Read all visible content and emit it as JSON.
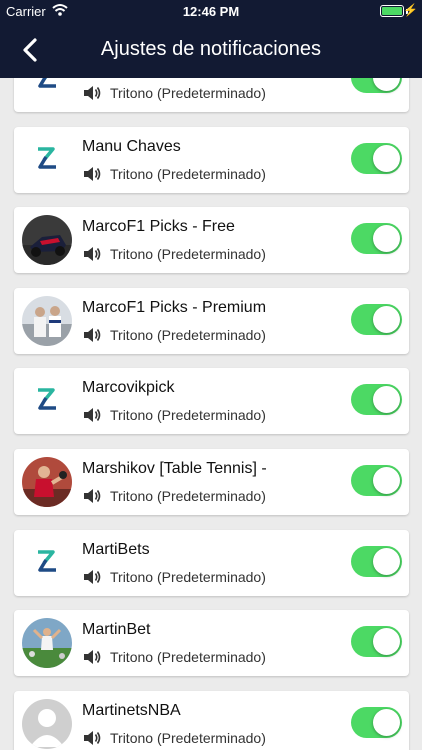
{
  "status_bar": {
    "carrier": "Carrier",
    "time": "12:46 PM",
    "wifi_icon": "wifi-icon",
    "battery_icon": "battery-icon",
    "charging_icon": "charging-bolt-icon"
  },
  "nav": {
    "title": "Ajustes de notificaciones",
    "back_icon": "chevron-left-icon"
  },
  "colors": {
    "nav_bg": "#121a33",
    "toggle_on": "#4cd964",
    "list_bg": "#ebebeb"
  },
  "items": [
    {
      "name": "",
      "sound": "Tritono (Predeterminado)",
      "avatar": "logo",
      "enabled": true
    },
    {
      "name": "Manu Chaves",
      "sound": "Tritono (Predeterminado)",
      "avatar": "logo",
      "enabled": true
    },
    {
      "name": "MarcoF1 Picks - Free",
      "sound": "Tritono (Predeterminado)",
      "avatar": "photo-racecar",
      "enabled": true
    },
    {
      "name": "MarcoF1 Picks - Premium",
      "sound": "Tritono (Predeterminado)",
      "avatar": "photo-drivers",
      "enabled": true
    },
    {
      "name": "Marcovikpick",
      "sound": "Tritono (Predeterminado)",
      "avatar": "logo",
      "enabled": true
    },
    {
      "name": "Marshikov [Table Tennis] -",
      "sound": "Tritono (Predeterminado)",
      "avatar": "photo-table-tennis",
      "enabled": true
    },
    {
      "name": "MartiBets",
      "sound": "Tritono (Predeterminado)",
      "avatar": "logo",
      "enabled": true
    },
    {
      "name": "MartinBet",
      "sound": "Tritono (Predeterminado)",
      "avatar": "photo-football",
      "enabled": true
    },
    {
      "name": "MartinetsNBA",
      "sound": "Tritono (Predeterminado)",
      "avatar": "default-user",
      "enabled": true
    }
  ]
}
